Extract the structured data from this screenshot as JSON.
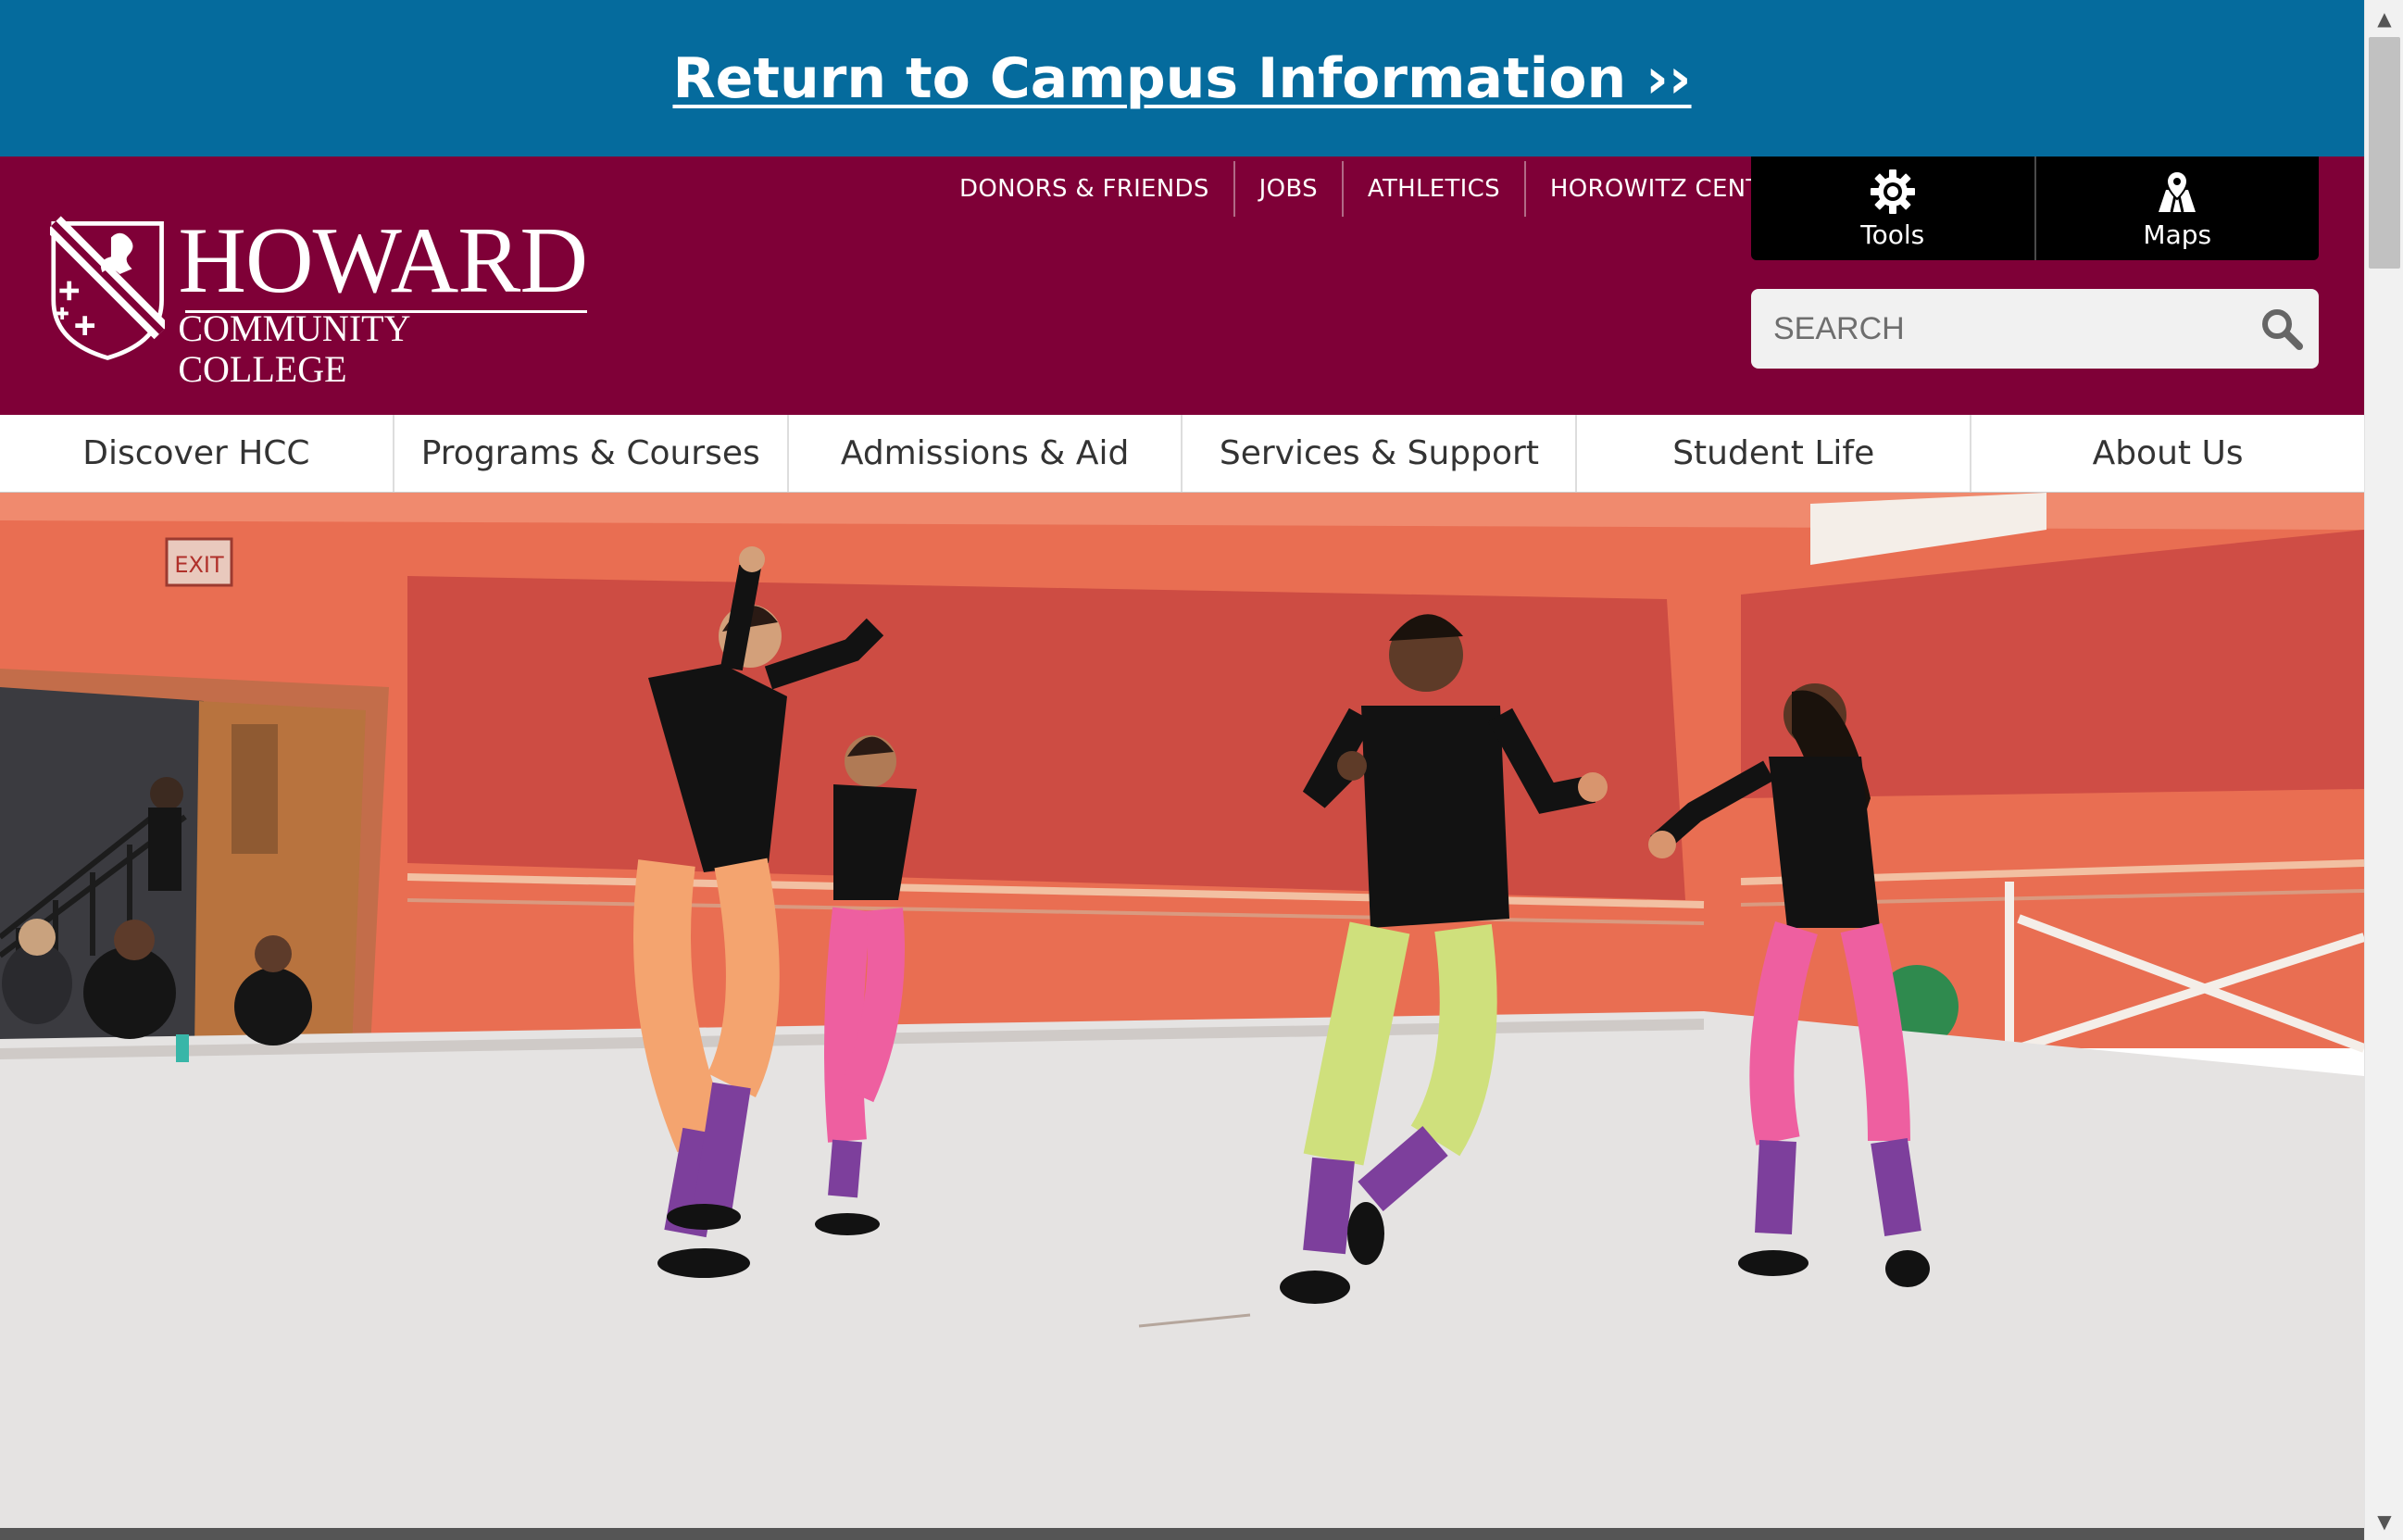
{
  "alert": {
    "text": "Return to Campus Information ››"
  },
  "logo": {
    "main": "HOWARD",
    "sub": "COMMUNITY COLLEGE"
  },
  "utility_nav": [
    {
      "label": "DONORS & FRIENDS"
    },
    {
      "label": "JOBS"
    },
    {
      "label": "ATHLETICS"
    },
    {
      "label": "HOROWITZ CENTER"
    }
  ],
  "tools": [
    {
      "label": "Tools",
      "icon": "gear-icon"
    },
    {
      "label": "Maps",
      "icon": "map-pin-icon"
    }
  ],
  "search": {
    "placeholder": "SEARCH",
    "icon": "search-icon"
  },
  "main_nav": [
    {
      "label": "Discover HCC"
    },
    {
      "label": "Programs & Courses"
    },
    {
      "label": "Admissions & Aid"
    },
    {
      "label": "Services & Support"
    },
    {
      "label": "Student Life"
    },
    {
      "label": "About Us"
    }
  ],
  "hero": {
    "sign": "EXIT"
  },
  "colors": {
    "alert_bg": "#056b9d",
    "header_bg": "#7f0037",
    "tools_bg": "#000000",
    "nav_text": "#333333"
  }
}
